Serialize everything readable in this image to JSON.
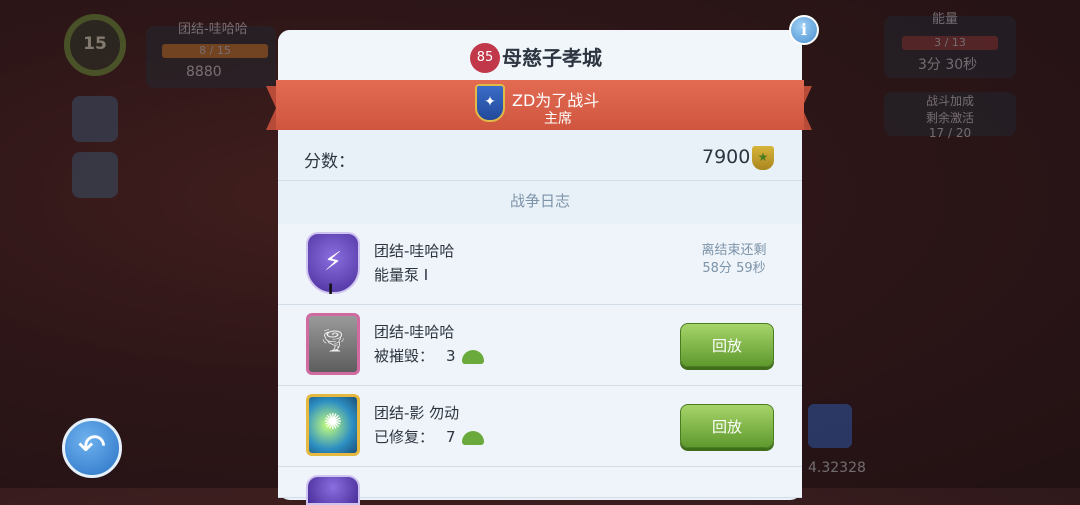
{
  "background_hud": {
    "player_level": "15",
    "player_name": "团结-哇哈哈",
    "player_progress": "8 / 15",
    "player_score": "8880",
    "energy_title": "能量",
    "energy_value": "3 / 13",
    "energy_timer": "3分 30秒",
    "boost_title": "战斗加成",
    "boost_sub": "剩余激活",
    "boost_value": "17 / 20",
    "corner_value": "4.32328"
  },
  "dialog": {
    "level_badge": "85",
    "title": "母慈子孝城",
    "info_icon": "i",
    "clan_name": "ZD为了战斗",
    "clan_role": "主席",
    "score_label": "分数：",
    "score_value": "7900",
    "war_log_title": "战争日志"
  },
  "log_entries": [
    {
      "name": "团结-哇哈哈",
      "sub": "能量泵 I",
      "icon": "lightning-icon",
      "timer_line1": "离结束还剩",
      "timer_line2": "58分 59秒"
    },
    {
      "name": "团结-哇哈哈",
      "sub_label": "被摧毁：",
      "sub_value": "3",
      "icon": "tornado-icon",
      "button": "回放"
    },
    {
      "name": "团结-影 勿动",
      "sub_label": "已修复：",
      "sub_value": "7",
      "icon": "energy-burst-icon",
      "button": "回放"
    }
  ],
  "colors": {
    "ribbon": "#d9604a",
    "replay_button": "#7fb947",
    "dialog_bg": "#e9f1f8",
    "back_button": "#2a73c6"
  }
}
